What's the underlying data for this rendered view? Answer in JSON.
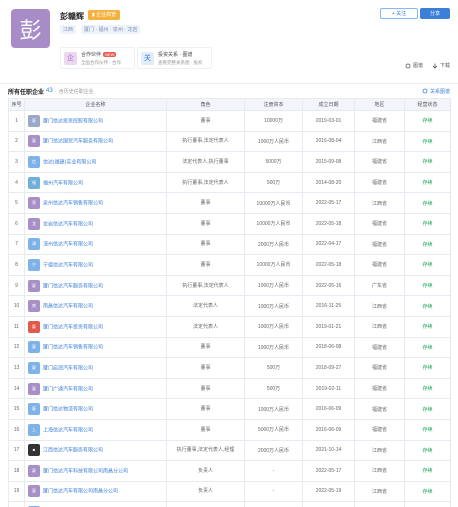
{
  "profile": {
    "avatar_char": "彭",
    "name": "彭赣辉",
    "tag": "▮ 企业高管",
    "subtags": [
      "江西",
      "厦门 · 福州 · 泉州 · 龙岩"
    ],
    "follow_label": "+ 关注",
    "share_label": "分享"
  },
  "cards": [
    {
      "icon": "企",
      "title": "合作伙伴",
      "badge": "NEW",
      "sub": "全国合作伙伴 · 合作"
    },
    {
      "icon": "关",
      "title": "投资关系 · 图谱",
      "sub": "查看完整关系图 · 股权"
    }
  ],
  "tools": [
    "图谱",
    "下载"
  ],
  "section": {
    "title": "所有任职企业",
    "count": "43",
    "note": "含历史任职企业",
    "more": "关系图谱"
  },
  "table": {
    "headers": [
      "序号",
      "企业名称",
      "角色",
      "注册资本",
      "成立日期",
      "地区",
      "经营状态"
    ],
    "rows": [
      {
        "idx": "1",
        "logo": "厦",
        "logo_color": "#9aa9c9",
        "name": "厦门信达投资控股有限公司",
        "role": "董事",
        "capital": "10000万",
        "date": "2019-03-01",
        "region": "福建省",
        "status": "存续"
      },
      {
        "idx": "2",
        "logo": "厦",
        "logo_color": "#a78fc7",
        "name": "厦门信达国贸汽车服务有限公司",
        "role": "执行董事,法定代表人",
        "capital": "1000万人民币",
        "date": "2016-08-04",
        "region": "江西省",
        "status": "存续"
      },
      {
        "idx": "3",
        "logo": "信",
        "logo_color": "#7db3e8",
        "name": "信达(福建)实业有限公司",
        "role": "法定代表人,执行董事",
        "capital": "5000万",
        "date": "2015-09-08",
        "region": "福建省",
        "status": "存续"
      },
      {
        "idx": "4",
        "logo": "福",
        "logo_color": "#6fb0d6",
        "name": "福州汽车有限公司",
        "role": "执行董事,法定代表人",
        "capital": "500万",
        "date": "2014-08-20",
        "region": "福建省",
        "status": "存续"
      },
      {
        "idx": "5",
        "logo": "泉",
        "logo_color": "#a78fc7",
        "name": "泉州信达汽车销售有限公司",
        "role": "董事",
        "capital": "10000万人民币",
        "date": "2022-05-17",
        "region": "江西省",
        "status": "存续"
      },
      {
        "idx": "6",
        "logo": "龙",
        "logo_color": "#a78fc7",
        "name": "龙岩信达汽车有限公司",
        "role": "董事",
        "capital": "10000万人民币",
        "date": "2022-05-18",
        "region": "福建省",
        "status": "存续"
      },
      {
        "idx": "7",
        "logo": "漳",
        "logo_color": "#7db3e8",
        "name": "漳州信达汽车有限公司",
        "role": "董事",
        "capital": "2000万人民币",
        "date": "2022-04-17",
        "region": "福建省",
        "status": "存续"
      },
      {
        "idx": "8",
        "logo": "宁",
        "logo_color": "#7db3e8",
        "name": "宁德信达汽车有限公司",
        "role": "董事",
        "capital": "10000万人民币",
        "date": "2022-05-18",
        "region": "福建省",
        "status": "存续"
      },
      {
        "idx": "9",
        "logo": "厦",
        "logo_color": "#a78fc7",
        "name": "厦门信达汽车服务有限公司",
        "role": "执行董事,法定代表人",
        "capital": "1000万人民币",
        "date": "2022-05-16",
        "region": "广东省",
        "status": "存续"
      },
      {
        "idx": "10",
        "logo": "南",
        "logo_color": "#a78fc7",
        "name": "南昌信达汽车有限公司",
        "role": "法定代表人",
        "capital": "1000万人民币",
        "date": "2016-11-25",
        "region": "江西省",
        "status": "存续"
      },
      {
        "idx": "11",
        "logo": "厦",
        "logo_color": "#e05b4c",
        "name": "厦门信达汽车投资有限公司",
        "role": "法定代表人",
        "capital": "1000万人民币",
        "date": "2019-01-21",
        "region": "江西省",
        "status": "存续"
      },
      {
        "idx": "12",
        "logo": "厦",
        "logo_color": "#7db3e8",
        "name": "厦门信达汽车销售有限公司",
        "role": "董事",
        "capital": "1000万人民币",
        "date": "2018-06-08",
        "region": "福建省",
        "status": "存续"
      },
      {
        "idx": "13",
        "logo": "厦",
        "logo_color": "#7db3e8",
        "name": "厦门启润汽车有限公司",
        "role": "董事",
        "capital": "500万",
        "date": "2018-09-27",
        "region": "福建省",
        "status": "存续"
      },
      {
        "idx": "14",
        "logo": "厦",
        "logo_color": "#a78fc7",
        "name": "厦门广通汽车有限公司",
        "role": "董事",
        "capital": "500万",
        "date": "2019-02-11",
        "region": "福建省",
        "status": "存续"
      },
      {
        "idx": "15",
        "logo": "厦",
        "logo_color": "#7db3e8",
        "name": "厦门信达物流有限公司",
        "role": "董事",
        "capital": "1000万人民币",
        "date": "2016-06-09",
        "region": "福建省",
        "status": "存续"
      },
      {
        "idx": "16",
        "logo": "上",
        "logo_color": "#7db3e8",
        "name": "上海信达汽车有限公司",
        "role": "董事",
        "capital": "5000万人民币",
        "date": "2016-06-09",
        "region": "福建省",
        "status": "存续"
      },
      {
        "idx": "17",
        "logo": "■",
        "logo_color": "#333333",
        "name": "江西信达汽车服务有限公司",
        "role": "执行董事,法定代表人,经理",
        "capital": "2000万人民币",
        "date": "2021-10-14",
        "region": "江西省",
        "status": "存续"
      },
      {
        "idx": "18",
        "logo": "厦",
        "logo_color": "#a78fc7",
        "name": "厦门信达汽车科技有限公司南昌分公司",
        "role": "负责人",
        "capital": "-",
        "date": "2022-05-17",
        "region": "江西省",
        "status": "存续"
      },
      {
        "idx": "19",
        "logo": "厦",
        "logo_color": "#a78fc7",
        "name": "厦门信达汽车有限公司南昌分公司",
        "role": "负责人",
        "capital": "-",
        "date": "2022-05-19",
        "region": "江西省",
        "status": "存续"
      },
      {
        "idx": "20",
        "logo": "厦",
        "logo_color": "#7db3e8",
        "name": "厦门信达汽车有限公司赣州分公司",
        "role": "负责人",
        "capital": "-",
        "date": "2022-05-26",
        "region": "广东省",
        "status": "存续"
      }
    ]
  }
}
